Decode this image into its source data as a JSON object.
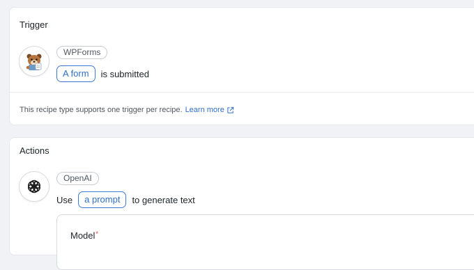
{
  "trigger": {
    "title": "Trigger",
    "integration": "WPForms",
    "token": "A form",
    "suffix": "is submitted",
    "note": "This recipe type supports one trigger per recipe.",
    "learn_more": "Learn more"
  },
  "actions": {
    "title": "Actions",
    "integration": "OpenAI",
    "lead": "Use",
    "token": "a prompt",
    "suffix": "to generate text",
    "model_label": "Model",
    "required_mark": "*"
  },
  "colors": {
    "accent": "#2f6fc7",
    "required": "#d63638",
    "background": "#f1f2f5"
  },
  "icons": {
    "trigger": "wpforms-bear-icon",
    "action": "openai-logo-icon",
    "learn_more": "external-link-icon"
  }
}
